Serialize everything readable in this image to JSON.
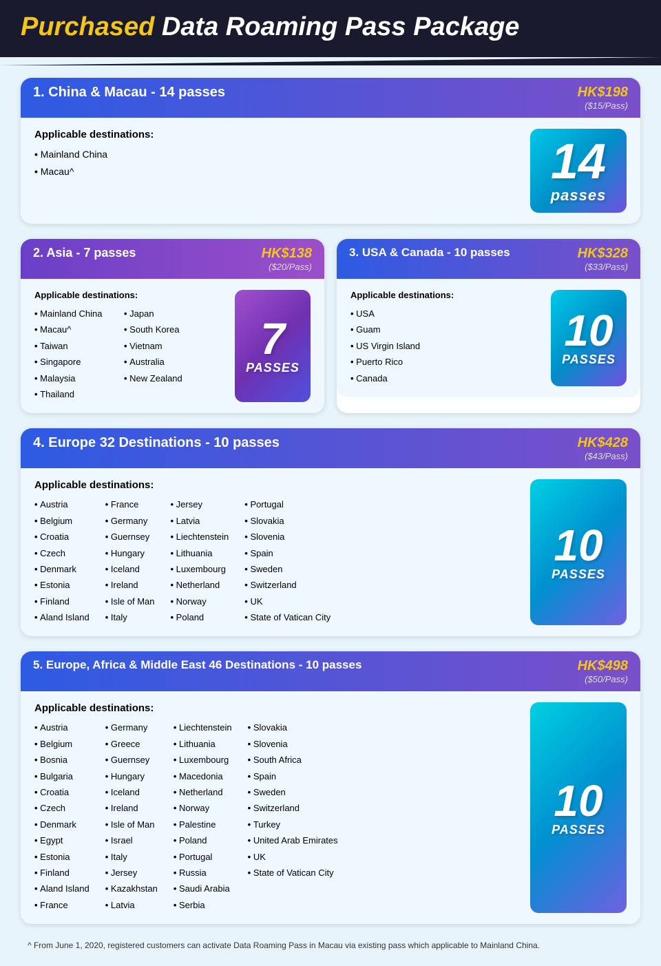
{
  "header": {
    "title_highlight": "Purchased",
    "title_rest": " Data Roaming Pass Package"
  },
  "packages": [
    {
      "id": "pkg1",
      "number": "1",
      "name": "China & Macau",
      "passes_label": "14 passes",
      "price": "HK$198",
      "per_pass": "($15/Pass)",
      "applicable_label": "Applicable destinations:",
      "destinations_col1": [
        "Mainland China",
        "Macau^"
      ],
      "destinations_col2": [],
      "pass_count": "14",
      "pass_word": "passes",
      "badge_style": "cyan"
    },
    {
      "id": "pkg2",
      "number": "2",
      "name": "Asia",
      "passes_label": "7 passes",
      "price": "HK$138",
      "per_pass": "($20/Pass)",
      "applicable_label": "Applicable destinations:",
      "destinations_col1": [
        "Mainland China",
        "Macau^",
        "Taiwan",
        "Singapore",
        "Malaysia",
        "Thailand"
      ],
      "destinations_col2": [
        "Japan",
        "South Korea",
        "Vietnam",
        "Australia",
        "New Zealand"
      ],
      "pass_count": "7",
      "pass_word": "PASSES",
      "badge_style": "purple"
    },
    {
      "id": "pkg3",
      "number": "3",
      "name": "USA & Canada",
      "passes_label": "10 passes",
      "price": "HK$328",
      "per_pass": "($33/Pass)",
      "applicable_label": "Applicable destinations:",
      "destinations_col1": [
        "USA",
        "Guam",
        "US Virgin Island",
        "Puerto Rico",
        "Canada"
      ],
      "destinations_col2": [],
      "pass_count": "10",
      "pass_word": "PASSES",
      "badge_style": "cyan"
    },
    {
      "id": "pkg4",
      "number": "4",
      "name": "Europe 32 Destinations",
      "passes_label": "10 passes",
      "price": "HK$428",
      "per_pass": "($43/Pass)",
      "applicable_label": "Applicable destinations:",
      "dest_grid": [
        [
          "Austria",
          "Belgium",
          "Croatia",
          "Czech",
          "Denmark",
          "Estonia",
          "Finland",
          "Aland Island"
        ],
        [
          "France",
          "Germany",
          "Guernsey",
          "Hungary",
          "Iceland",
          "Ireland",
          "Isle of Man",
          "Italy"
        ],
        [
          "Jersey",
          "Latvia",
          "Liechtenstein",
          "Lithuania",
          "Luxembourg",
          "Netherland",
          "Norway",
          "Poland"
        ],
        [
          "Portugal",
          "Slovakia",
          "Slovenia",
          "Spain",
          "Sweden",
          "Switzerland",
          "UK",
          "State of Vatican City"
        ]
      ],
      "pass_count": "10",
      "pass_word": "PASSES",
      "badge_style": "cyan2"
    },
    {
      "id": "pkg5",
      "number": "5",
      "name": "Europe, Africa & Middle East 46 Destinations",
      "passes_label": "10 passes",
      "price": "HK$498",
      "per_pass": "($50/Pass)",
      "applicable_label": "Applicable destinations:",
      "dest_grid": [
        [
          "Austria",
          "Belgium",
          "Bosnia",
          "Bulgaria",
          "Croatia",
          "Czech",
          "Denmark",
          "Egypt",
          "Estonia",
          "Finland",
          "Aland Island",
          "France"
        ],
        [
          "Germany",
          "Greece",
          "Guernsey",
          "Hungary",
          "Iceland",
          "Ireland",
          "Isle of Man",
          "Israel",
          "Italy",
          "Jersey",
          "Kazakhstan",
          "Latvia"
        ],
        [
          "Liechtenstein",
          "Lithuania",
          "Luxembourg",
          "Macedonia",
          "Netherland",
          "Norway",
          "Palestine",
          "Poland",
          "Portugal",
          "Russia",
          "Saudi Arabia",
          "Serbia"
        ],
        [
          "Slovakia",
          "Slovenia",
          "South Africa",
          "Spain",
          "Sweden",
          "Switzerland",
          "Turkey",
          "United Arab Emirates",
          "UK",
          "State of Vatican City"
        ]
      ],
      "pass_count": "10",
      "pass_word": "PASSES",
      "badge_style": "cyan2"
    }
  ],
  "footnote": "^ From June 1, 2020, registered customers can activate Data Roaming Pass in Macau via existing pass which applicable to Mainland China."
}
